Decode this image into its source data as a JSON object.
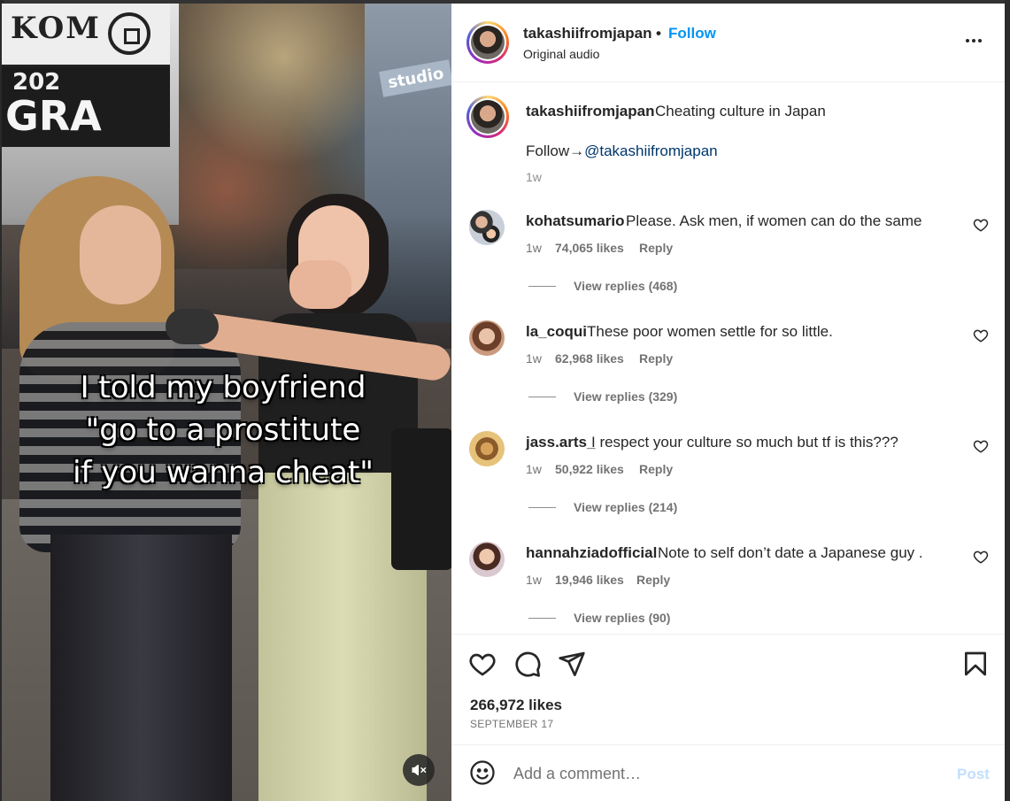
{
  "video": {
    "caption_text": "I told my boyfriend\n\"go to a prostitute\nif you wanna cheat\"",
    "sign_text_1": "KOM",
    "sign_text_2": "202",
    "sign_text_3": "GRA",
    "muted_icon": "speaker-muted-icon"
  },
  "header": {
    "username": "takashiifromjapan",
    "separator": "•",
    "follow_label": "Follow",
    "audio_label": "Original audio",
    "more_icon": "more-horizontal-icon"
  },
  "post_caption": {
    "username": "takashiifromjapan",
    "text": "Cheating culture in Japan",
    "follow_prefix": "Follow→",
    "mention": "@takashiifromjapan",
    "time": "1w"
  },
  "comments": [
    {
      "username": "kohatsumario",
      "text": "Please. Ask men, if women can do the same",
      "time": "1w",
      "likes": "74,065 likes",
      "reply_label": "Reply",
      "view_replies": "View replies (468)"
    },
    {
      "username": "la_coqui",
      "text": "These poor women settle for so little.",
      "time": "1w",
      "likes": "62,968 likes",
      "reply_label": "Reply",
      "view_replies": "View replies (329)"
    },
    {
      "username": "jass.arts_",
      "text": "I respect your culture so much but tf is this???",
      "time": "1w",
      "likes": "50,922 likes",
      "reply_label": "Reply",
      "view_replies": "View replies (214)"
    },
    {
      "username": "hannahziadofficial",
      "text": "Note to self don’t date a Japanese guy .",
      "time": "1w",
      "likes": "19,946 likes",
      "reply_label": "Reply",
      "view_replies": "View replies (90)"
    }
  ],
  "actions": {
    "like_icon": "heart-icon",
    "comment_icon": "comment-bubble-icon",
    "share_icon": "paper-plane-icon",
    "save_icon": "bookmark-icon"
  },
  "stats": {
    "likes": "266,972 likes",
    "date": "SEPTEMBER 17"
  },
  "composer": {
    "placeholder": "Add a comment…",
    "post_label": "Post",
    "emoji_icon": "smiley-icon"
  },
  "colors": {
    "accent": "#0095f6",
    "text": "#262626",
    "muted": "#737373",
    "post_disabled": "#c0dffd"
  }
}
